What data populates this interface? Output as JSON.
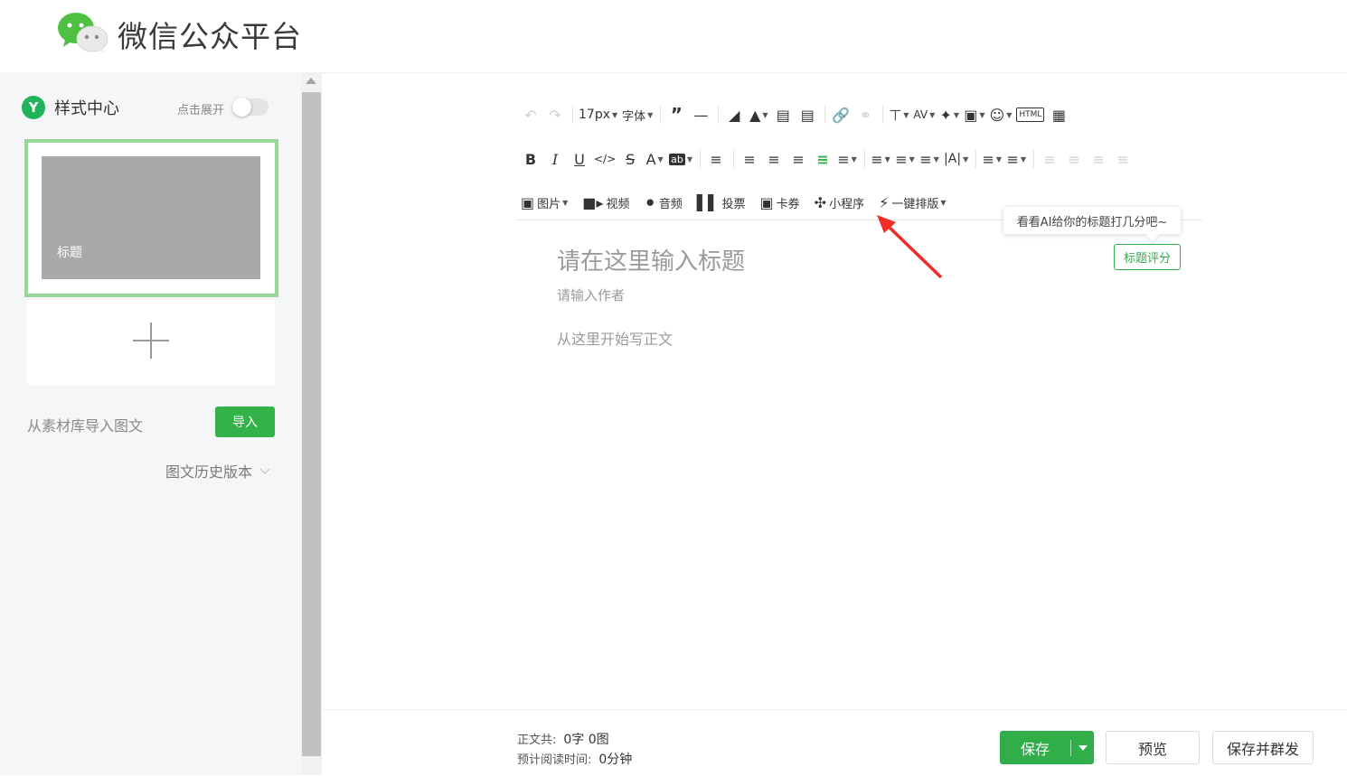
{
  "header": {
    "brand": "微信公众平台"
  },
  "sidebar": {
    "style_center": {
      "icon_letter": "Y",
      "label": "样式中心",
      "expand_label": "点击展开"
    },
    "card": {
      "title": "标题"
    },
    "import": {
      "label": "从素材库导入图文",
      "button": "导入"
    },
    "history": "图文历史版本"
  },
  "toolbar": {
    "row1": {
      "font_size": "17px",
      "font_family": "字体"
    },
    "row3": {
      "image": "图片",
      "video": "视频",
      "audio": "音频",
      "vote": "投票",
      "card": "卡券",
      "miniprogram": "小程序",
      "layout": "一键排版"
    }
  },
  "editor": {
    "title_placeholder": "请在这里输入标题",
    "author_placeholder": "请输入作者",
    "body_placeholder": "从这里开始写正文"
  },
  "tooltip": "看看AI给你的标题打几分吧~",
  "score_button": "标题评分",
  "footer": {
    "count_label": "正文共:",
    "count_value": "0字 0图",
    "read_label": "预计阅读时间:",
    "read_value": "0分钟",
    "save": "保存",
    "preview": "预览",
    "save_mass": "保存并群发"
  },
  "colors": {
    "accent": "#2fae4a",
    "card_border": "#96d996",
    "annotation_arrow": "#f02c24"
  }
}
